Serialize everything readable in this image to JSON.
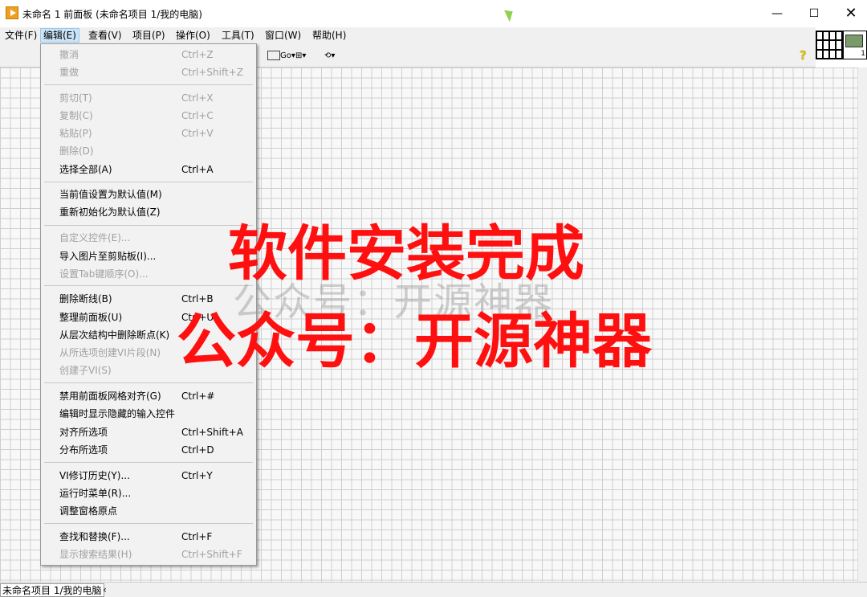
{
  "window": {
    "title": "未命名 1 前面板 (未命名项目 1/我的电脑)",
    "minimize": "—",
    "maximize": "☐",
    "close": "✕"
  },
  "menubar": {
    "items": [
      {
        "label": "文件(F)"
      },
      {
        "label": "编辑(E)"
      },
      {
        "label": "查看(V)"
      },
      {
        "label": "项目(P)"
      },
      {
        "label": "操作(O)"
      },
      {
        "label": "工具(T)"
      },
      {
        "label": "窗口(W)"
      },
      {
        "label": "帮助(H)"
      }
    ],
    "active_index": 1
  },
  "toolbar": {
    "align_label": "Go▾",
    "distribute_label": "⊞▾",
    "reorder_label": "⟲▾",
    "help_icon": "?"
  },
  "edit_menu": {
    "items": [
      {
        "label": "撤消",
        "shortcut": "Ctrl+Z",
        "enabled": false
      },
      {
        "label": "重做",
        "shortcut": "Ctrl+Shift+Z",
        "enabled": false
      },
      {
        "label": "剪切(T)",
        "shortcut": "Ctrl+X",
        "enabled": false
      },
      {
        "label": "复制(C)",
        "shortcut": "Ctrl+C",
        "enabled": false
      },
      {
        "label": "粘贴(P)",
        "shortcut": "Ctrl+V",
        "enabled": false
      },
      {
        "label": "删除(D)",
        "shortcut": "",
        "enabled": false
      },
      {
        "label": "选择全部(A)",
        "shortcut": "Ctrl+A",
        "enabled": true
      },
      {
        "label": "当前值设置为默认值(M)",
        "shortcut": "",
        "enabled": true
      },
      {
        "label": "重新初始化为默认值(Z)",
        "shortcut": "",
        "enabled": true
      },
      {
        "label": "自定义控件(E)...",
        "shortcut": "",
        "enabled": false
      },
      {
        "label": "导入图片至剪贴板(I)...",
        "shortcut": "",
        "enabled": true
      },
      {
        "label": "设置Tab键顺序(O)...",
        "shortcut": "",
        "enabled": false
      },
      {
        "label": "删除断线(B)",
        "shortcut": "Ctrl+B",
        "enabled": true
      },
      {
        "label": "整理前面板(U)",
        "shortcut": "Ctrl+U",
        "enabled": true
      },
      {
        "label": "从层次结构中删除断点(K)",
        "shortcut": "",
        "enabled": true
      },
      {
        "label": "从所选项创建VI片段(N)",
        "shortcut": "",
        "enabled": false
      },
      {
        "label": "创建子VI(S)",
        "shortcut": "",
        "enabled": false
      },
      {
        "label": "禁用前面板网格对齐(G)",
        "shortcut": "Ctrl+#",
        "enabled": true
      },
      {
        "label": "编辑时显示隐藏的输入控件",
        "shortcut": "",
        "enabled": true
      },
      {
        "label": "对齐所选项",
        "shortcut": "Ctrl+Shift+A",
        "enabled": true
      },
      {
        "label": "分布所选项",
        "shortcut": "Ctrl+D",
        "enabled": true
      },
      {
        "label": "VI修订历史(Y)...",
        "shortcut": "Ctrl+Y",
        "enabled": true
      },
      {
        "label": "运行时菜单(R)...",
        "shortcut": "",
        "enabled": true
      },
      {
        "label": "调整窗格原点",
        "shortcut": "",
        "enabled": true
      },
      {
        "label": "查找和替换(F)...",
        "shortcut": "Ctrl+F",
        "enabled": true
      },
      {
        "label": "显示搜索结果(H)",
        "shortcut": "Ctrl+Shift+F",
        "enabled": false
      }
    ]
  },
  "status": {
    "context": "未命名项目 1/我的电脑"
  },
  "vi_icon": {
    "number": "1"
  },
  "overlay": {
    "line1": "软件安装完成",
    "line2": "公众号：开源神器",
    "faint": "公众号：开源神器"
  },
  "colors": {
    "overlay_red": "#ff1010",
    "menu_highlight": "#cce4f7",
    "grid_line": "#cfcfcf"
  }
}
